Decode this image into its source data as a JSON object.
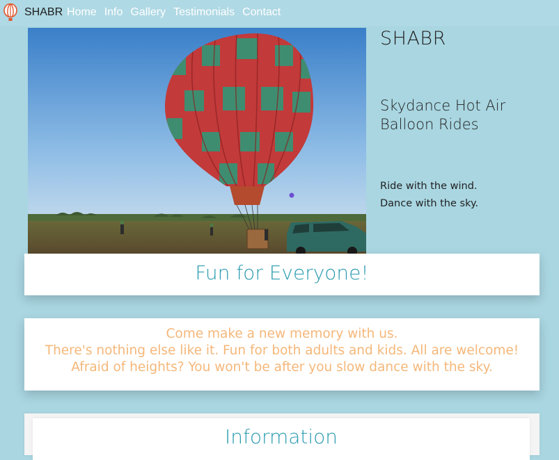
{
  "navbar": {
    "brand": "SHABR",
    "links": [
      {
        "label": "Home"
      },
      {
        "label": "Info"
      },
      {
        "label": "Gallery"
      },
      {
        "label": "Testimonials"
      },
      {
        "label": "Contact"
      }
    ]
  },
  "hero": {
    "title": "SHABR",
    "subtitle": "Skydance Hot Air Balloon Rides",
    "tagline_lines": [
      "Ride with the wind.",
      "Dance with the sky."
    ]
  },
  "cards": {
    "fun": {
      "title": "Fun for Everyone!"
    },
    "memory": {
      "lines": [
        "Come make a new memory with us.",
        "There's nothing else like it. Fun for both adults and kids. All are welcome!",
        "Afraid of heights? You won't be after you slow dance with the sky."
      ]
    },
    "info": {
      "title": "Information"
    }
  },
  "colors": {
    "background": "#a9d6e1",
    "accent_teal": "#2a9bb0",
    "accent_orange": "#f5b779"
  },
  "icons": {
    "logo": "hot-air-balloon-icon"
  }
}
